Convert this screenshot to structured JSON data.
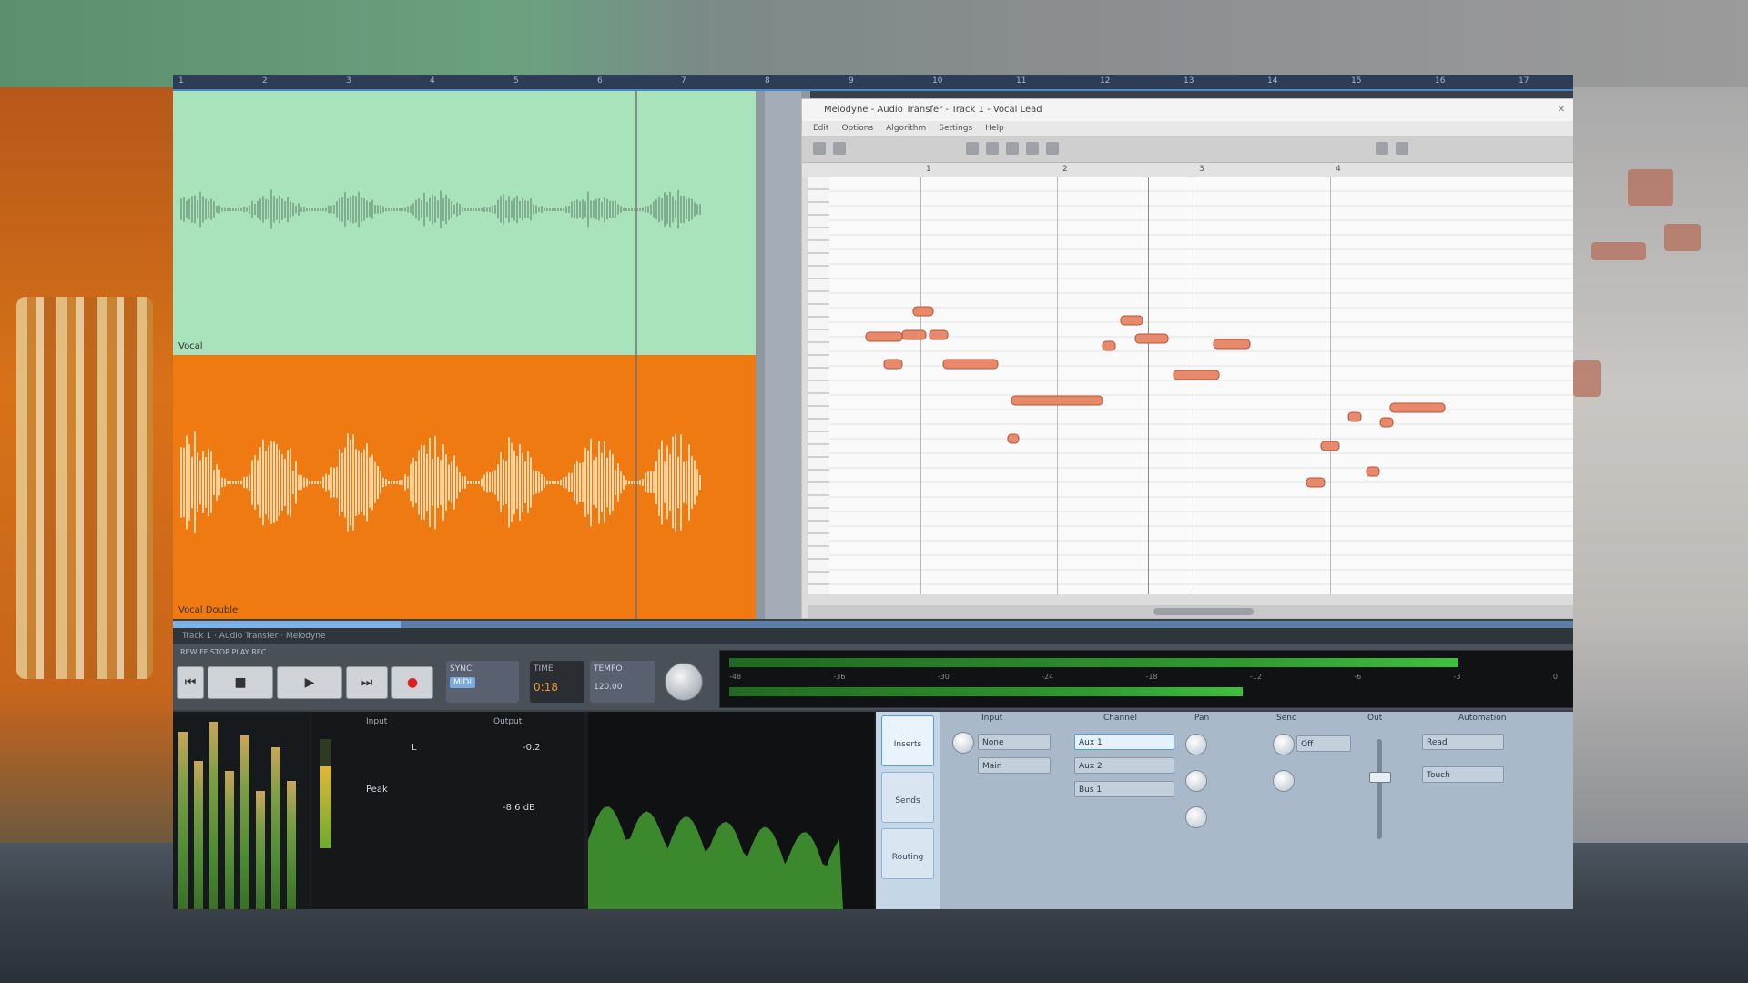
{
  "app": {
    "plugin_title": "Melodyne - Audio Transfer - Track 1 - Vocal Lead",
    "plugin_menu": [
      "Edit",
      "Options",
      "Algorithm",
      "Settings",
      "Help"
    ],
    "ruler_marks": [
      "1",
      "2",
      "3",
      "4",
      "5",
      "6",
      "7",
      "8",
      "9",
      "10",
      "11",
      "12",
      "13",
      "14",
      "15",
      "16",
      "17"
    ],
    "plugin_ruler_marks": [
      "1",
      "2",
      "3",
      "4"
    ],
    "tracks": [
      {
        "name": "Vocal",
        "color": "#a8e3bb"
      },
      {
        "name": "Vocal Double",
        "color": "#f07a12"
      }
    ]
  },
  "info_strip": "Track 1 · Audio Transfer · Melodyne",
  "transport": {
    "labels": "REW   FF   STOP   PLAY   REC",
    "sync_label": "SYNC",
    "sync_value": "MIDI",
    "time_label": "TIME",
    "time_value": "0:18",
    "tempo_label": "TEMPO",
    "tempo_value": "120.00",
    "buttons": [
      "⏮",
      "■",
      "▶",
      "⏭",
      "●"
    ]
  },
  "meter": {
    "ticks": [
      "-48",
      "-36",
      "-30",
      "-24",
      "-18",
      "-12",
      "-6",
      "-3",
      "0"
    ],
    "levels": [
      0.88,
      0.62,
      0.8
    ]
  },
  "stats": {
    "col1": "Input",
    "col2": "Output",
    "row1a": "L",
    "row1b": "-0.2",
    "row2a": "Peak",
    "row2b": "-8.6 dB"
  },
  "mixer": {
    "tabs": [
      "Inserts",
      "Sends",
      "Routing"
    ],
    "headers": [
      "Input",
      "Channel",
      "Pan",
      "Send",
      "Out",
      "Automation"
    ],
    "fields": [
      "None",
      "Main",
      "Aux 1",
      "Aux 2",
      "Bus 1",
      "Off",
      "Read",
      "Touch"
    ]
  }
}
